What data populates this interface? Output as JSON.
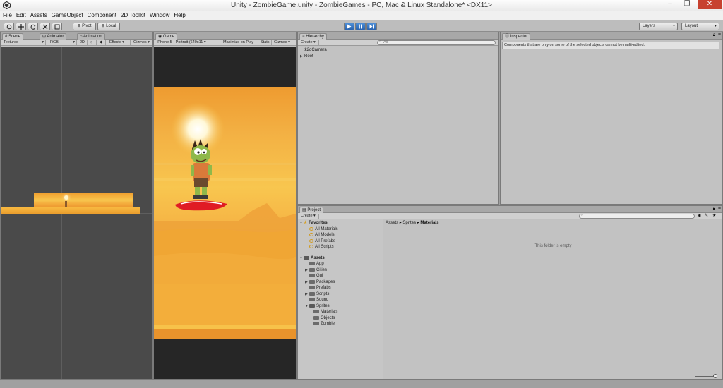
{
  "window": {
    "title": "Unity - ZombieGame.unity - ZombieGames - PC, Mac & Linux Standalone* <DX11>",
    "minimize": "–",
    "maximize": "❐",
    "close": "✕"
  },
  "menu": [
    "File",
    "Edit",
    "Assets",
    "GameObject",
    "Component",
    "2D Toolkit",
    "Window",
    "Help"
  ],
  "toolbar": {
    "pivot": "Pivot",
    "local": "Local",
    "layers": "Layers",
    "layout": "Layout"
  },
  "scene_panel": {
    "tabs": [
      "Scene",
      "Animator",
      "Animation"
    ],
    "render_mode": "Textured",
    "color_mode": "RGB",
    "mode_2d": "2D",
    "effects": "Effects",
    "gizmos": "Gizmos"
  },
  "game_panel": {
    "tab": "Game",
    "resolution": "iPhone 5 - Portrait (640x11",
    "maximize_on_play": "Maximize on Play",
    "stats": "Stats",
    "gizmos": "Gizmos"
  },
  "hierarchy": {
    "tab": "Hierarchy",
    "create": "Create",
    "search_placeholder": "All",
    "items": [
      {
        "label": "tk2dCamera",
        "expandable": false
      },
      {
        "label": "Root",
        "expandable": true
      }
    ]
  },
  "inspector": {
    "tab": "Inspector",
    "message": "Components that are only on some of the selected objects cannot be multi-edited."
  },
  "project": {
    "tab": "Project",
    "create": "Create",
    "favorites_label": "Favorites",
    "favorites": [
      "All Materials",
      "All Models",
      "All Prefabs",
      "All Scripts"
    ],
    "assets_label": "Assets",
    "assets": [
      {
        "label": "App",
        "arrow": false,
        "indent": 1
      },
      {
        "label": "Cities",
        "arrow": true,
        "indent": 1
      },
      {
        "label": "Gui",
        "arrow": false,
        "indent": 1
      },
      {
        "label": "Packages",
        "arrow": true,
        "indent": 1
      },
      {
        "label": "Prefabs",
        "arrow": false,
        "indent": 1
      },
      {
        "label": "Scripts",
        "arrow": true,
        "indent": 1
      },
      {
        "label": "Sound",
        "arrow": false,
        "indent": 1
      },
      {
        "label": "Sprites",
        "arrow": true,
        "indent": 1,
        "open": true
      },
      {
        "label": "Materials",
        "arrow": false,
        "indent": 2
      },
      {
        "label": "Objects",
        "arrow": false,
        "indent": 2
      },
      {
        "label": "Zombie",
        "arrow": false,
        "indent": 2
      }
    ],
    "breadcrumb": [
      "Assets",
      "Sprites",
      "Materials"
    ],
    "empty_message": "This folder is empty"
  },
  "colors": {
    "sky_top": "#f1a53a",
    "sky_mid": "#f6c24f",
    "dune": "#f0a030",
    "sand": "#e8902a",
    "play_accent": "#2f6fc4",
    "board": "#e01b24",
    "zombie_skin": "#8fb84a"
  }
}
